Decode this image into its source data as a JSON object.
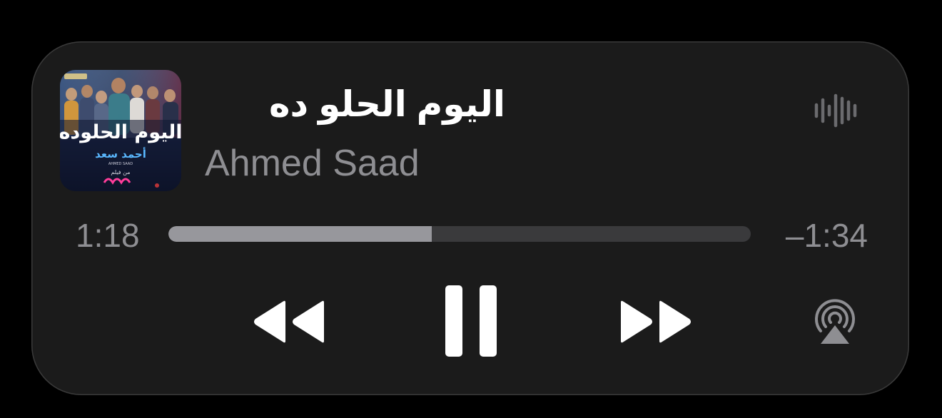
{
  "now_playing": {
    "title": "اليوم الحلو ده",
    "artist": "Ahmed Saad",
    "artwork": {
      "title_text": "اليوم الحلوده",
      "artist_text": "أحمد سعد",
      "artist_latin": "AHMED SAAD",
      "subtitle": "من فيلم"
    }
  },
  "progress": {
    "elapsed": "1:18",
    "remaining": "–1:34",
    "fraction": 0.452
  },
  "icons": {
    "waveform": "waveform-icon",
    "rewind": "rewind-icon",
    "pause": "pause-icon",
    "forward": "fast-forward-icon",
    "airplay": "airplay-audio-icon"
  },
  "colors": {
    "card_background": "#1b1b1b",
    "title": "#ffffff",
    "secondary_text": "#8e8e92",
    "track": "#3a3a3c",
    "track_fill": "#97979c",
    "waveform": "#6b6b6e"
  }
}
